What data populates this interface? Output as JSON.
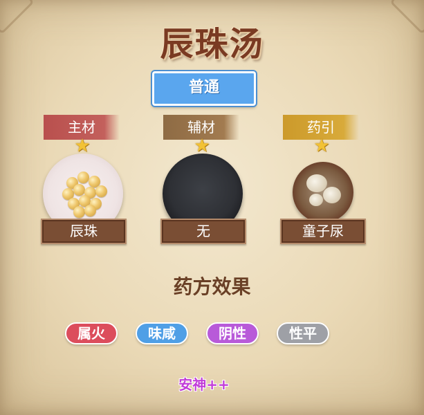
{
  "title": "辰珠汤",
  "grade": "普通",
  "slots": [
    {
      "label": "主材",
      "name": "辰珠",
      "star_icon": "star-icon",
      "color": "#c3605c"
    },
    {
      "label": "辅材",
      "name": "无",
      "star_icon": "star-icon",
      "color": "#a27b50"
    },
    {
      "label": "药引",
      "name": "童子尿",
      "star_icon": "star-icon",
      "color": "#d8aa3a"
    }
  ],
  "effects": {
    "title": "药方效果",
    "tags": [
      {
        "label": "属火",
        "color": "#dc4d5c"
      },
      {
        "label": "味咸",
        "color": "#4f9fe6"
      },
      {
        "label": "阴性",
        "color": "#b85ad9"
      },
      {
        "label": "性平",
        "color": "#9ea0a6"
      }
    ],
    "line": "安神++"
  },
  "colors": {
    "title": "#7a3a22",
    "grade_badge": "#5aa6ee",
    "effect_line": "#c13dd8"
  }
}
